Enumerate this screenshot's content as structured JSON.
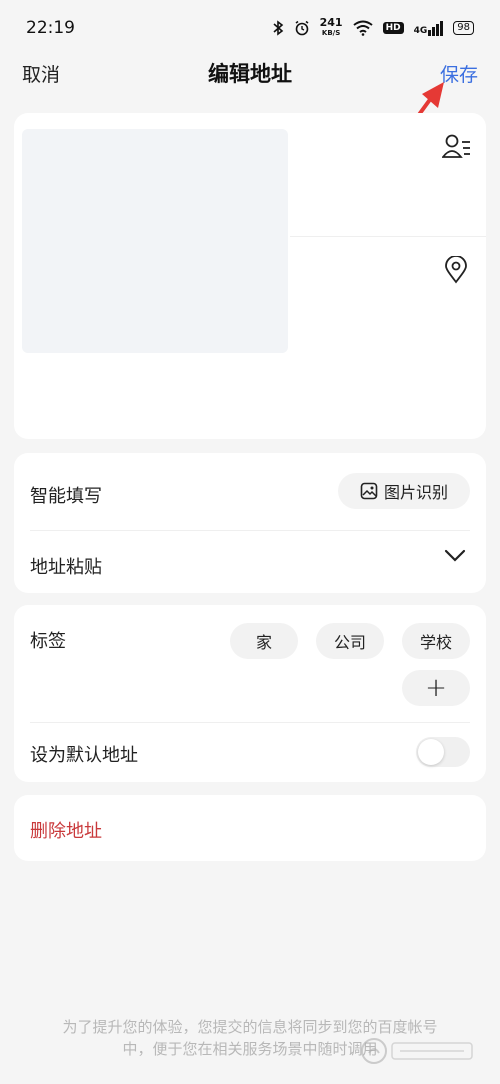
{
  "status_bar": {
    "time": "22:19",
    "speed_value": "241",
    "speed_unit": "KB/S",
    "hd": "HD",
    "network": "4G",
    "battery": "98"
  },
  "nav": {
    "cancel": "取消",
    "title": "编辑地址",
    "save": "保存"
  },
  "smart_fill": {
    "label": "智能填写",
    "image_button": "图片识别",
    "paste_label": "地址粘贴"
  },
  "tags": {
    "label": "标签",
    "items": [
      "家",
      "公司",
      "学校"
    ],
    "add": "+",
    "default_label": "设为默认地址",
    "default_on": false
  },
  "delete": {
    "label": "删除地址"
  },
  "footer": {
    "line1": "为了提升您的体验，您提交的信息将同步到您的百度帐号",
    "line2": "中，便于您在相关服务场景中随时调用"
  },
  "colors": {
    "accent": "#3b6fe0",
    "danger": "#c9393b",
    "arrow": "#e53935"
  },
  "icons": {
    "bluetooth": "bluetooth-icon",
    "alarm": "alarm-icon",
    "wifi": "wifi-icon",
    "contact": "contact-book-icon",
    "location": "location-pin-icon",
    "image": "image-icon",
    "chevron": "chevron-down-icon"
  }
}
